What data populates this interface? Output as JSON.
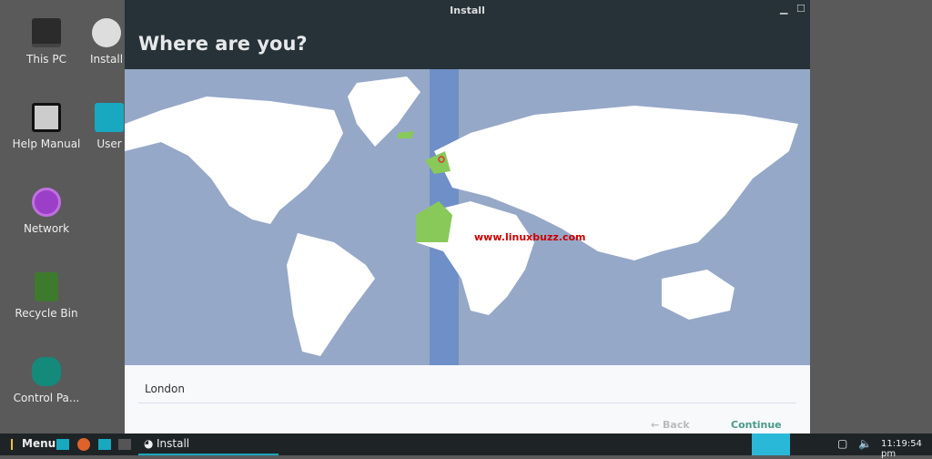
{
  "desktop": [
    {
      "label": "This PC",
      "icon": "computer-icon"
    },
    {
      "label": "Install",
      "icon": "disc-icon"
    },
    {
      "label": "Help Manual",
      "icon": "map-book-icon"
    },
    {
      "label": "User",
      "icon": "home-folder-icon"
    },
    {
      "label": "Network",
      "icon": "globe-icon"
    },
    {
      "label": "Recycle Bin",
      "icon": "trash-icon"
    },
    {
      "label": "Control Pa...",
      "icon": "wrench-icon"
    }
  ],
  "window": {
    "title": "Install",
    "heading": "Where are you?",
    "watermark": "www.linuxbuzz.com",
    "location": "London",
    "back": "← Back",
    "continue": "Continue"
  },
  "taskbar": {
    "menu": "Menu",
    "task": "Install",
    "clock": "11:19:54 pm"
  },
  "colors": {
    "ocean": "#96a8c8",
    "selected_zone": "#6f8fc8",
    "highlight": "#88c95a",
    "titlebar": "#263238",
    "accent": "#4a9a8a"
  }
}
